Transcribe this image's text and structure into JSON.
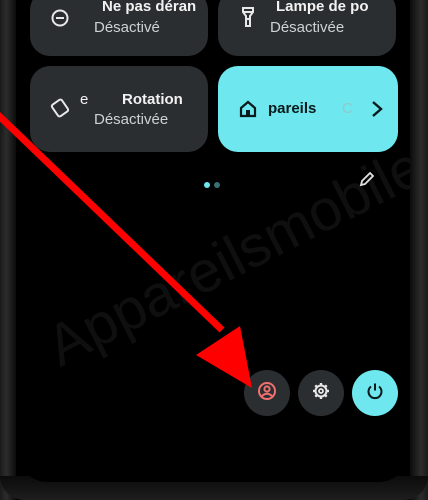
{
  "quick_tiles": {
    "dnd": {
      "title": "Ne pas déran",
      "status": "Désactivé",
      "icon": "do-not-disturb-icon"
    },
    "flashlight": {
      "title": "Lampe de po",
      "status": "Désactivée",
      "icon": "flashlight-icon"
    },
    "rotation": {
      "title_left": "e",
      "title": "Rotation",
      "status": "Désactivée",
      "icon": "auto-rotate-icon"
    },
    "devices": {
      "title": "pareils",
      "trailing": "C",
      "icon": "home-icon"
    }
  },
  "footer": {
    "buttons": [
      {
        "name": "user-button",
        "icon": "user-icon"
      },
      {
        "name": "settings-button",
        "icon": "gear-icon"
      },
      {
        "name": "power-button",
        "icon": "power-icon"
      }
    ],
    "edit_icon": "pencil-icon"
  },
  "watermark": "Appareilsmobiles.fr",
  "colors": {
    "tile_bg": "#2a2e31",
    "accent": "#6ee7ef",
    "user_icon": "#f07070",
    "arrow": "#ff0000",
    "page_dot_active": "#6ee7ef",
    "page_dot_inactive": "#3a6f74"
  }
}
